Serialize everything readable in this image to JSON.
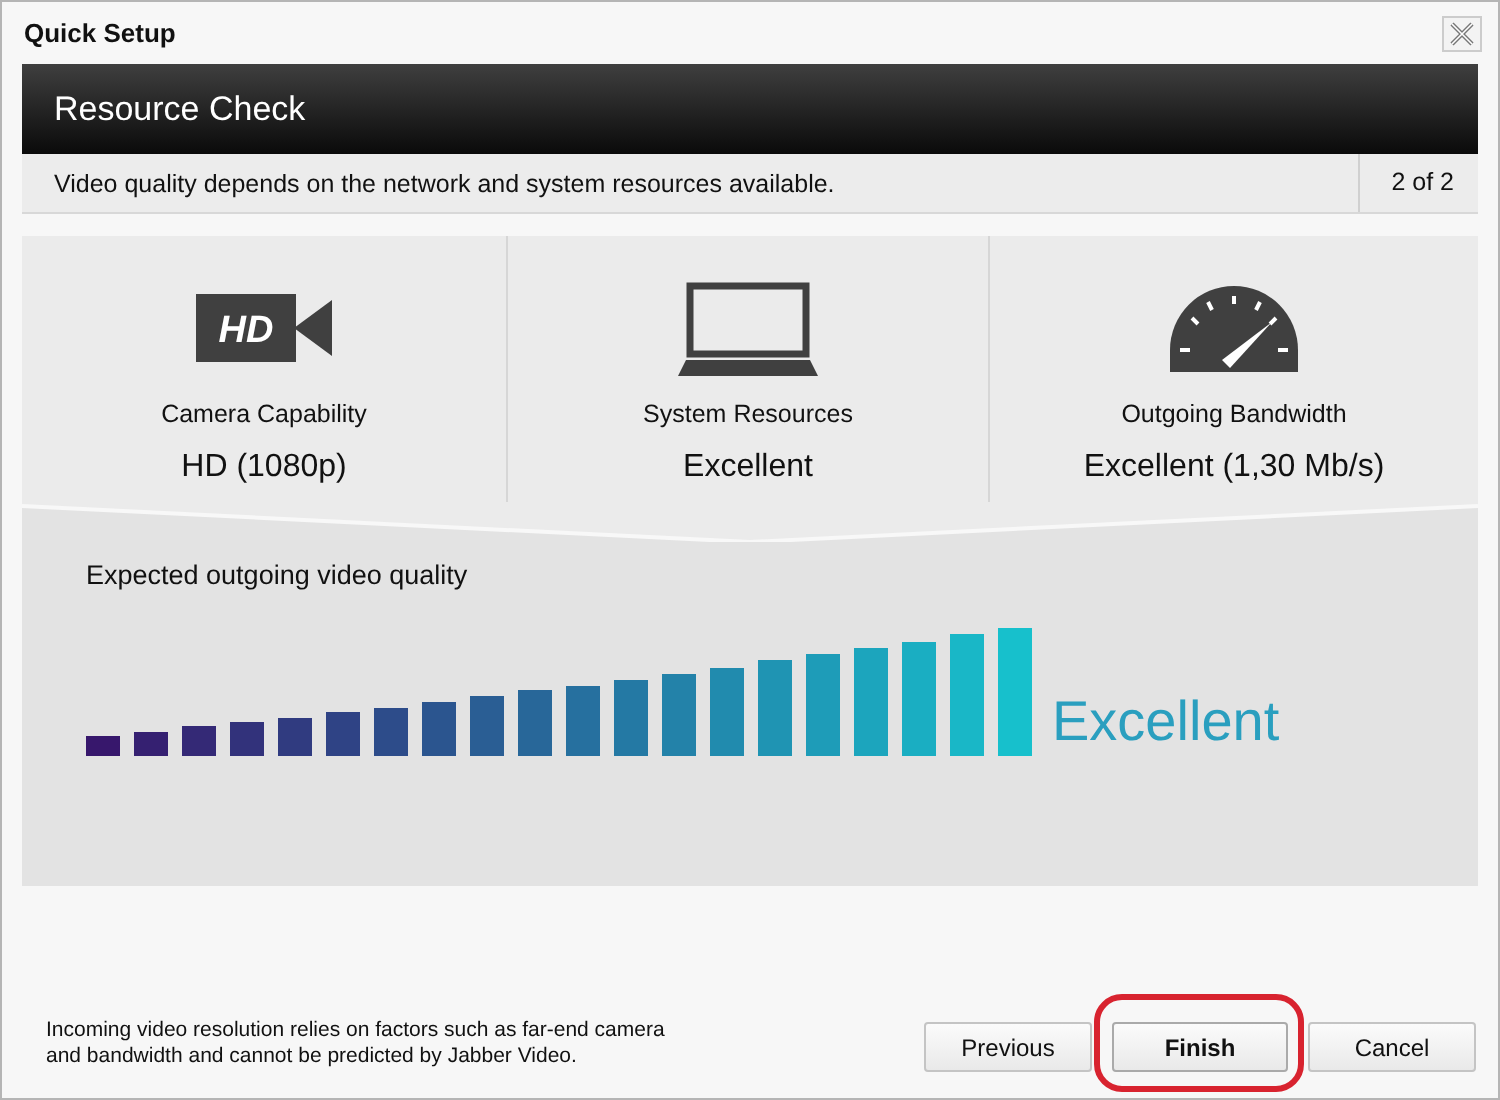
{
  "window": {
    "title": "Quick Setup"
  },
  "header": {
    "title": "Resource Check"
  },
  "info_bar": {
    "text": "Video quality depends on the network and system resources available.",
    "step": "2 of 2"
  },
  "cards": [
    {
      "kind": "camera",
      "icon_label": "HD",
      "label": "Camera Capability",
      "value": "HD (1080p)"
    },
    {
      "kind": "laptop",
      "label": "System Resources",
      "value": "Excellent"
    },
    {
      "kind": "gauge",
      "label": "Outgoing Bandwidth",
      "value": "Excellent (1,30 Mb/s)"
    }
  ],
  "quality": {
    "label": "Expected outgoing video quality",
    "reading": "Excellent"
  },
  "footer_note": "Incoming video resolution relies on factors such as far-end camera and bandwidth and cannot be predicted by Jabber Video.",
  "buttons": [
    {
      "label": "Previous",
      "default": false,
      "highlighted": false
    },
    {
      "label": "Finish",
      "default": true,
      "highlighted": true
    },
    {
      "label": "Cancel",
      "default": false,
      "highlighted": false
    }
  ]
}
